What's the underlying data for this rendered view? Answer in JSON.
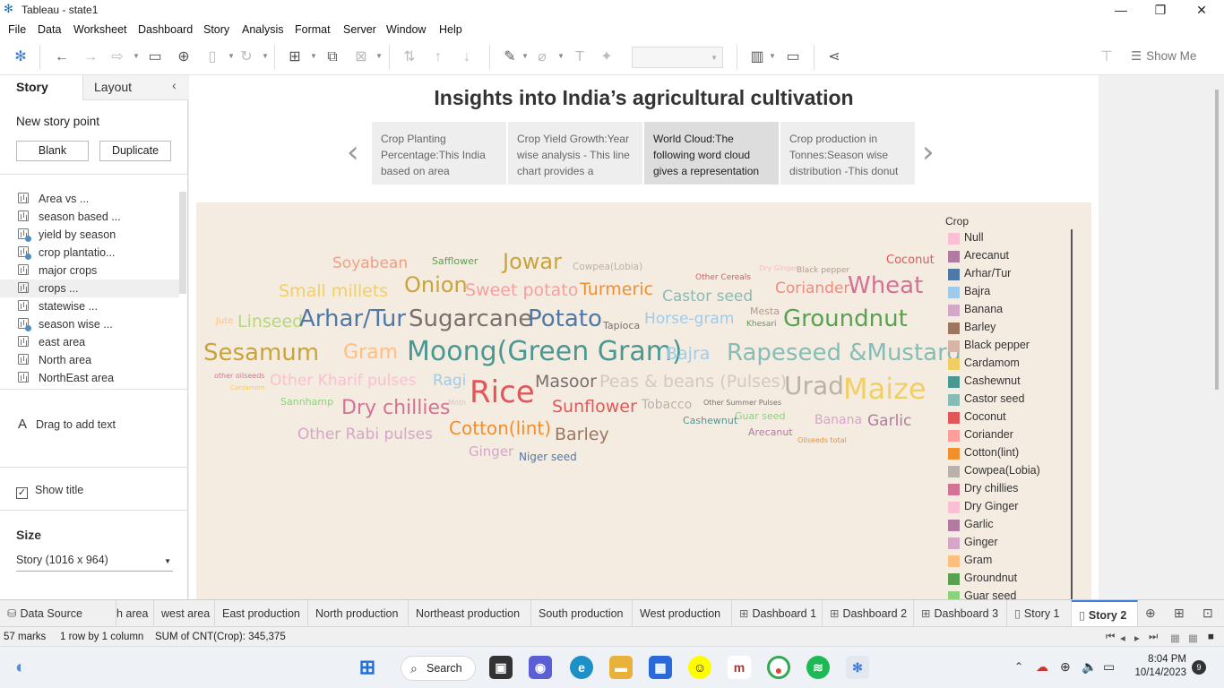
{
  "window": {
    "title": "Tableau - state1",
    "minimize": "—",
    "restore": "❐",
    "close": "✕"
  },
  "menu": [
    "File",
    "Data",
    "Worksheet",
    "Dashboard",
    "Story",
    "Analysis",
    "Format",
    "Server",
    "Window",
    "Help"
  ],
  "toolbar": {
    "show_me": "Show Me"
  },
  "left_pane": {
    "tab_story": "Story",
    "tab_layout": "Layout",
    "new_story_point": "New story point",
    "blank_button": "Blank",
    "duplicate_button": "Duplicate",
    "sheets": [
      {
        "label": "Area vs ...",
        "badge": false
      },
      {
        "label": "season based ...",
        "badge": false
      },
      {
        "label": "yield by season",
        "badge": true
      },
      {
        "label": "crop plantatio...",
        "badge": true
      },
      {
        "label": "major crops",
        "badge": false
      },
      {
        "label": "crops ...",
        "badge": false
      },
      {
        "label": "statewise ...",
        "badge": false
      },
      {
        "label": "season wise ...",
        "badge": true
      },
      {
        "label": "east area",
        "badge": false
      },
      {
        "label": "North area",
        "badge": false
      },
      {
        "label": "NorthEast area",
        "badge": false
      }
    ],
    "drag_text": "Drag to add text",
    "show_title": "Show title",
    "size_label": "Size",
    "size_value": "Story (1016 x 964)"
  },
  "story": {
    "title": "Insights into India’s agricultural cultivation",
    "points": [
      "Crop Planting Percentage:This India based on area",
      "Crop Yield Growth:Year wise analysis - This line chart provides a",
      "World Cloud:The following word cloud gives a representation",
      "Crop production in Tonnes:Season wise distribution -This donut"
    ],
    "active_point": 2
  },
  "word_cloud": {
    "words": [
      {
        "text": "Soyabean",
        "size": 17,
        "color": "#ef9f84"
      },
      {
        "text": "Safflower",
        "size": 11,
        "color": "#59a14f"
      },
      {
        "text": "Jowar",
        "size": 24,
        "color": "#c9a43a"
      },
      {
        "text": "Cowpea(Lobia)",
        "size": 10.5,
        "color": "#bab0ac"
      },
      {
        "text": "Other Cereals",
        "size": 9,
        "color": "#e15759"
      },
      {
        "text": "Dry Ginger",
        "size": 8,
        "color": "#f7b6c2"
      },
      {
        "text": "Black pepper",
        "size": 9,
        "color": "#b09a8c"
      },
      {
        "text": "Coconut",
        "size": 13,
        "color": "#e15759"
      },
      {
        "text": "Small millets",
        "size": 19,
        "color": "#f2cf63"
      },
      {
        "text": "Onion",
        "size": 24,
        "color": "#c9a43a"
      },
      {
        "text": "Sweet potato",
        "size": 19,
        "color": "#f59f9f"
      },
      {
        "text": "Turmeric",
        "size": 19,
        "color": "#f28e2b"
      },
      {
        "text": "Castor seed",
        "size": 17,
        "color": "#86bcb6"
      },
      {
        "text": "Coriander",
        "size": 17,
        "color": "#ef8a7c"
      },
      {
        "text": "Wheat",
        "size": 26,
        "color": "#d37295"
      },
      {
        "text": "Jute",
        "size": 10,
        "color": "#ffbe7d"
      },
      {
        "text": "Linseed",
        "size": 19,
        "color": "#b6d77c"
      },
      {
        "text": "Arhar/Tur",
        "size": 26,
        "color": "#4e79a7"
      },
      {
        "text": "Sugarcane",
        "size": 26,
        "color": "#79706e"
      },
      {
        "text": "Potato",
        "size": 26,
        "color": "#4e79a7"
      },
      {
        "text": "Tapioca",
        "size": 11,
        "color": "#79706e"
      },
      {
        "text": "Horse-gram",
        "size": 17,
        "color": "#a0cbe8"
      },
      {
        "text": "Mesta",
        "size": 11,
        "color": "#b09a8c"
      },
      {
        "text": "Khesari",
        "size": 9,
        "color": "#59a14f"
      },
      {
        "text": "Groundnut",
        "size": 26,
        "color": "#59a14f"
      },
      {
        "text": "Sesamum",
        "size": 26,
        "color": "#c9a43a"
      },
      {
        "text": "Gram",
        "size": 22,
        "color": "#ffbe7d"
      },
      {
        "text": "Moong(Green Gram)",
        "size": 30,
        "color": "#499894"
      },
      {
        "text": "Bajra",
        "size": 19,
        "color": "#a0cbe8"
      },
      {
        "text": "Rapeseed &Mustard",
        "size": 26,
        "color": "#86bcb6"
      },
      {
        "text": "other oilseeds",
        "size": 8,
        "color": "#d37295"
      },
      {
        "text": "Other Kharif pulses",
        "size": 17,
        "color": "#fabfd2"
      },
      {
        "text": "Ragi",
        "size": 17,
        "color": "#a0cbe8"
      },
      {
        "text": "Rice",
        "size": 34,
        "color": "#e15759"
      },
      {
        "text": "Masoor",
        "size": 19,
        "color": "#79706e"
      },
      {
        "text": "Peas & beans (Pulses)",
        "size": 19,
        "color": "#d4c8c3"
      },
      {
        "text": "Urad",
        "size": 28,
        "color": "#bab0ac"
      },
      {
        "text": "Maize",
        "size": 32,
        "color": "#f2cf63"
      },
      {
        "text": "Cardamom",
        "size": 7,
        "color": "#f1ce63"
      },
      {
        "text": "Sannhamp",
        "size": 11,
        "color": "#8cd17d"
      },
      {
        "text": "Dry chillies",
        "size": 22,
        "color": "#d37295"
      },
      {
        "text": "Moth",
        "size": 8,
        "color": "#d4c8c3"
      },
      {
        "text": "Sunflower",
        "size": 19,
        "color": "#e15759"
      },
      {
        "text": "Tobacco",
        "size": 14,
        "color": "#bab0ac"
      },
      {
        "text": "Other Summer Pulses",
        "size": 8,
        "color": "#79706e"
      },
      {
        "text": "Guar seed",
        "size": 11,
        "color": "#8cd17d"
      },
      {
        "text": "Cashewnut",
        "size": 11,
        "color": "#499894"
      },
      {
        "text": "Banana",
        "size": 14,
        "color": "#d4a6c8"
      },
      {
        "text": "Garlic",
        "size": 17,
        "color": "#b07aa1"
      },
      {
        "text": "Arecanut",
        "size": 11,
        "color": "#b07aa1"
      },
      {
        "text": "Oilseeds total",
        "size": 8,
        "color": "#f28e2b"
      },
      {
        "text": "Other Rabi pulses",
        "size": 17,
        "color": "#d4a6c8"
      },
      {
        "text": "Cotton(lint)",
        "size": 20,
        "color": "#f28e2b"
      },
      {
        "text": "Barley",
        "size": 19,
        "color": "#9d7660"
      },
      {
        "text": "Ginger",
        "size": 15,
        "color": "#d4a6c8"
      },
      {
        "text": "Niger seed",
        "size": 12,
        "color": "#4e79a7"
      }
    ]
  },
  "legend": {
    "title": "Crop",
    "items": [
      {
        "label": "Null",
        "color": "#fabfd2"
      },
      {
        "label": "Arecanut",
        "color": "#b07aa1"
      },
      {
        "label": "Arhar/Tur",
        "color": "#4e79a7"
      },
      {
        "label": "Bajra",
        "color": "#a0cbe8"
      },
      {
        "label": "Banana",
        "color": "#d4a6c8"
      },
      {
        "label": "Barley",
        "color": "#9d7660"
      },
      {
        "label": "Black pepper",
        "color": "#d7b5a6"
      },
      {
        "label": "Cardamom",
        "color": "#f1ce63"
      },
      {
        "label": "Cashewnut",
        "color": "#499894"
      },
      {
        "label": "Castor seed",
        "color": "#86bcb6"
      },
      {
        "label": "Coconut",
        "color": "#e15759"
      },
      {
        "label": "Coriander",
        "color": "#ff9d9a"
      },
      {
        "label": "Cotton(lint)",
        "color": "#f28e2b"
      },
      {
        "label": "Cowpea(Lobia)",
        "color": "#bab0ac"
      },
      {
        "label": "Dry chillies",
        "color": "#d37295"
      },
      {
        "label": "Dry Ginger",
        "color": "#fabfd2"
      },
      {
        "label": "Garlic",
        "color": "#b07aa1"
      },
      {
        "label": "Ginger",
        "color": "#d4a6c8"
      },
      {
        "label": "Gram",
        "color": "#ffbe7d"
      },
      {
        "label": "Groundnut",
        "color": "#59a14f"
      },
      {
        "label": "Guar seed",
        "color": "#8cd17d"
      }
    ]
  },
  "tabs": {
    "data_source": "Data Source",
    "sheets": [
      "h area",
      "west area",
      "East production",
      "North production",
      "Northeast production",
      "South production",
      "West production"
    ],
    "dashboards": [
      "Dashboard 1",
      "Dashboard 2",
      "Dashboard 3"
    ],
    "stories": [
      "Story 1",
      "Story 2"
    ]
  },
  "status": {
    "marks": "57 marks",
    "rows": "1 row by 1 column",
    "sum": "SUM of CNT(Crop): 345,375"
  },
  "taskbar": {
    "search": "Search",
    "time": "8:04 PM",
    "date": "10/14/2023",
    "notif_count": "9"
  }
}
